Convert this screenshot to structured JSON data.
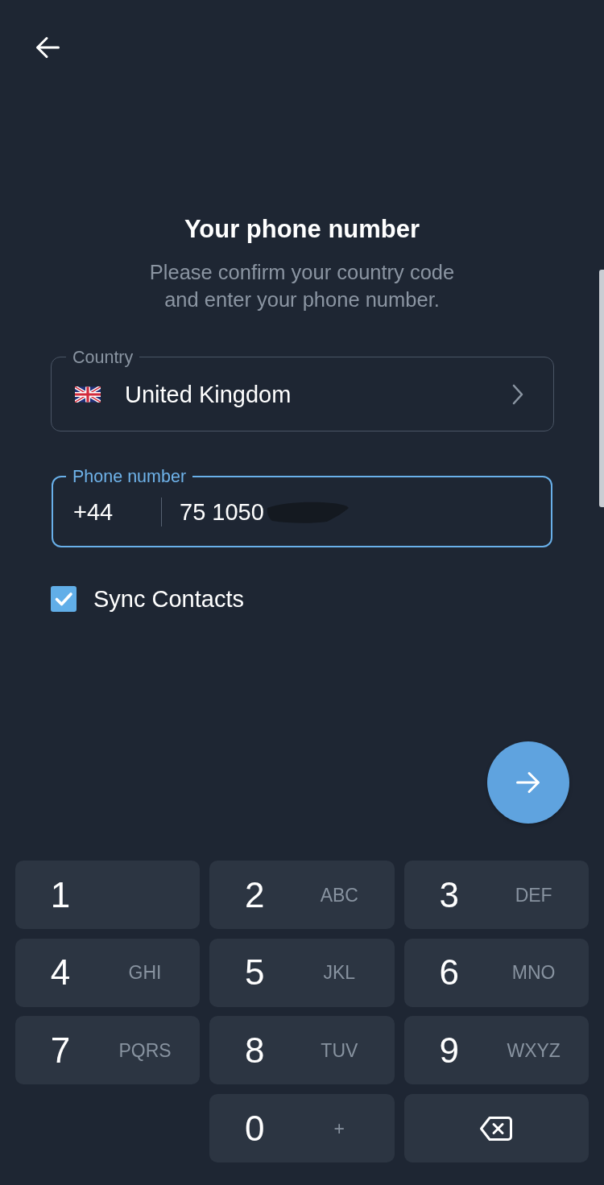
{
  "title": "Your phone number",
  "subtitle": "Please confirm your country code and enter your phone number.",
  "country_field": {
    "label": "Country",
    "value": "United Kingdom",
    "focused": false
  },
  "phone_field": {
    "label": "Phone number",
    "country_code": "+44",
    "value": "75 1050",
    "focused": true
  },
  "sync_contacts": {
    "label": "Sync Contacts",
    "checked": true
  },
  "keypad": {
    "rows": [
      [
        {
          "kind": "digit",
          "digit": "1"
        },
        {
          "kind": "digit",
          "digit": "2",
          "letters": "ABC"
        },
        {
          "kind": "digit",
          "digit": "3",
          "letters": "DEF"
        }
      ],
      [
        {
          "kind": "digit",
          "digit": "4",
          "letters": "GHI"
        },
        {
          "kind": "digit",
          "digit": "5",
          "letters": "JKL"
        },
        {
          "kind": "digit",
          "digit": "6",
          "letters": "MNO"
        }
      ],
      [
        {
          "kind": "digit",
          "digit": "7",
          "letters": "PQRS"
        },
        {
          "kind": "digit",
          "digit": "8",
          "letters": "TUV"
        },
        {
          "kind": "digit",
          "digit": "9",
          "letters": "WXYZ"
        }
      ],
      [
        "",
        {
          "kind": "digit",
          "digit": "0",
          "letters": "+"
        },
        {
          "kind": "backspace"
        }
      ]
    ]
  }
}
